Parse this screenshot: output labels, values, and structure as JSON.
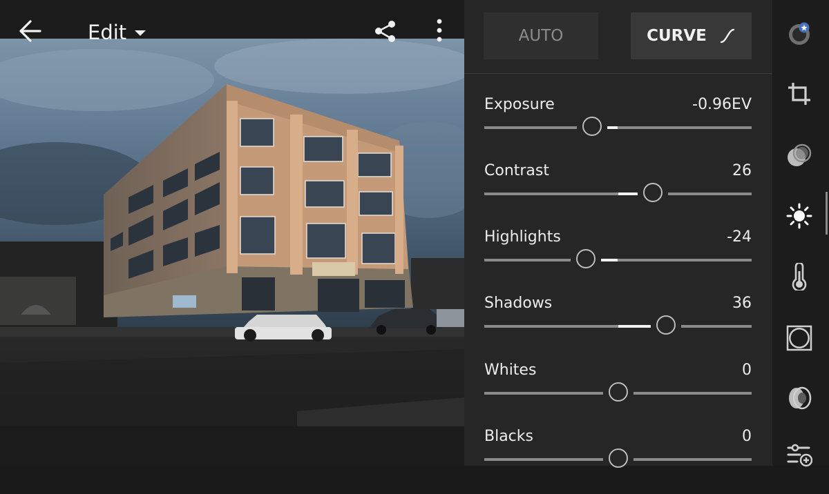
{
  "header": {
    "title": "Edit",
    "icons": [
      "back-arrow-icon",
      "dropdown-caret-icon",
      "share-icon",
      "more-vertical-icon"
    ]
  },
  "photo": {
    "subject": "four-storey building at dusk"
  },
  "panel": {
    "auto_label": "AUTO",
    "curve_label": "CURVE",
    "sliders": [
      {
        "label": "Exposure",
        "value": "-0.96EV",
        "level": -0.192
      },
      {
        "label": "Contrast",
        "value": "26",
        "level": 0.26
      },
      {
        "label": "Highlights",
        "value": "-24",
        "level": -0.24
      },
      {
        "label": "Shadows",
        "value": "36",
        "level": 0.36
      },
      {
        "label": "Whites",
        "value": "0",
        "level": 0
      },
      {
        "label": "Blacks",
        "value": "0",
        "level": 0
      }
    ]
  },
  "tools": [
    "presets-icon",
    "crop-icon",
    "selective-icon",
    "light-icon",
    "color-icon",
    "effects-icon",
    "optics-icon",
    "detail-icon"
  ],
  "active_tool": "light-icon",
  "colors": {
    "panel": "#262626",
    "rail": "#1c1c1c",
    "accent": "#f3f3f3",
    "track": "#8a8a8a"
  }
}
